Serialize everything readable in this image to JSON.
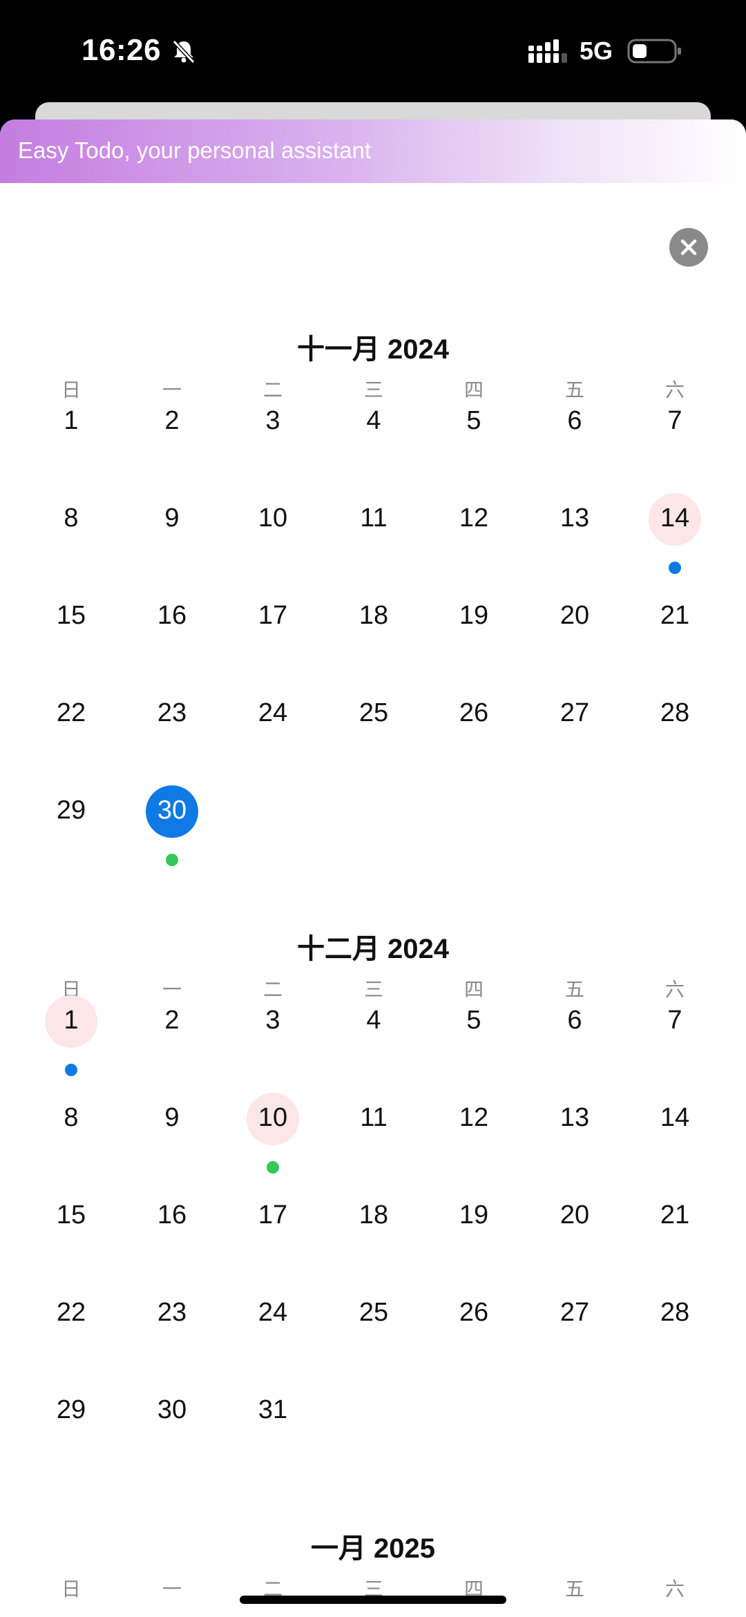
{
  "status": {
    "time": "16:26",
    "network": "5G"
  },
  "banner": {
    "text": "Easy Todo, your personal assistant"
  },
  "weekdays": [
    "日",
    "一",
    "二",
    "三",
    "四",
    "五",
    "六"
  ],
  "colors": {
    "accent_blue": "#0f7ae5",
    "highlight_pink": "#fde6e8",
    "dot_blue": "#0f7ae5",
    "dot_green": "#34c759"
  },
  "months": [
    {
      "title": "十一月 2024",
      "rows": [
        [
          "1",
          "2",
          "3",
          "4",
          "5",
          "6",
          "7"
        ],
        [
          "8",
          "9",
          "10",
          "11",
          "12",
          "13",
          "14"
        ],
        [
          "15",
          "16",
          "17",
          "18",
          "19",
          "20",
          "21"
        ],
        [
          "22",
          "23",
          "24",
          "25",
          "26",
          "27",
          "28"
        ],
        [
          "29",
          "30",
          "",
          "",
          "",
          "",
          ""
        ]
      ]
    },
    {
      "title": "十二月 2024",
      "rows": [
        [
          "1",
          "2",
          "3",
          "4",
          "5",
          "6",
          "7"
        ],
        [
          "8",
          "9",
          "10",
          "11",
          "12",
          "13",
          "14"
        ],
        [
          "15",
          "16",
          "17",
          "18",
          "19",
          "20",
          "21"
        ],
        [
          "22",
          "23",
          "24",
          "25",
          "26",
          "27",
          "28"
        ],
        [
          "29",
          "30",
          "31",
          "",
          "",
          "",
          ""
        ]
      ]
    },
    {
      "title": "一月 2025",
      "rows": []
    }
  ],
  "marked_days": [
    {
      "month": 0,
      "day": "14",
      "highlight": "pink",
      "dot": "blue"
    },
    {
      "month": 0,
      "day": "30",
      "highlight": "blue-selected",
      "dot": "green"
    },
    {
      "month": 1,
      "day": "1",
      "highlight": "pink",
      "dot": "blue"
    },
    {
      "month": 1,
      "day": "10",
      "highlight": "pink",
      "dot": "green"
    }
  ]
}
